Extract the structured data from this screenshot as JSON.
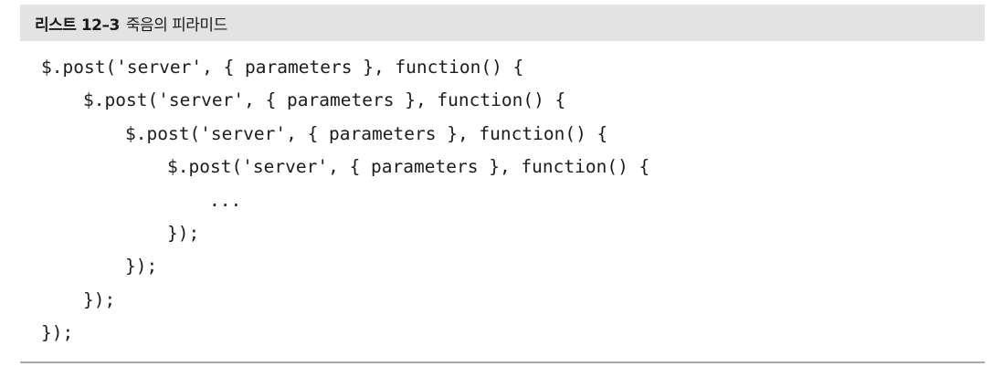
{
  "header": {
    "label": "리스트 12–3",
    "title": "죽음의 피라미드"
  },
  "code_lines": [
    "$.post('server', { parameters }, function() {",
    "$.post('server', { parameters }, function() {",
    "$.post('server', { parameters }, function() {",
    "$.post('server', { parameters }, function() {",
    "...",
    "});",
    "});",
    "});",
    "});"
  ]
}
